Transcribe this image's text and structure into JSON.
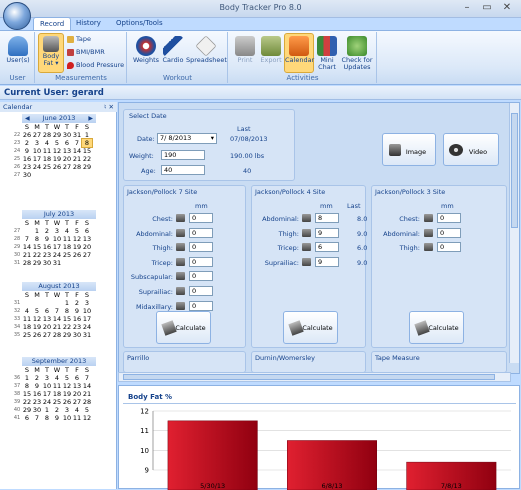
{
  "app": {
    "title": "Body Tracker Pro 8.0",
    "window_controls": [
      "–",
      "▭",
      "✕"
    ]
  },
  "tabs": [
    "Record",
    "History",
    "Options/Tools"
  ],
  "ribbon": {
    "user": {
      "button": "User(s)",
      "group": "User"
    },
    "measurements": {
      "body_fat_line1": "Body",
      "body_fat_line2": "Fat",
      "tape": "Tape",
      "bmi": "BMI/BMR",
      "blood_pressure": "Blood Pressure",
      "group": "Measurements"
    },
    "workout": {
      "weights": "Weights",
      "cardio": "Cardio",
      "spreadsheet": "Spreadsheet",
      "group": "Workout"
    },
    "activities": {
      "print": "Print",
      "export": "Export",
      "calendar": "Calendar",
      "mini_line1": "Mini",
      "mini_line2": "Chart",
      "check_line1": "Check for",
      "check_line2": "Updates",
      "group": "Activities"
    }
  },
  "user_bar": "Current User: gerard",
  "calendar": {
    "title": "Calendar",
    "pin": "♮ ✕",
    "months": [
      {
        "name": "June 2013",
        "weeks": [
          {
            "wk": "22",
            "days": [
              "26",
              "27",
              "28",
              "29",
              "30",
              "31",
              "1"
            ]
          },
          {
            "wk": "23",
            "days": [
              "2",
              "3",
              "4",
              "5",
              "6",
              "7",
              "8"
            ]
          },
          {
            "wk": "24",
            "days": [
              "9",
              "10",
              "11",
              "12",
              "13",
              "14",
              "15"
            ]
          },
          {
            "wk": "25",
            "days": [
              "16",
              "17",
              "18",
              "19",
              "20",
              "21",
              "22"
            ]
          },
          {
            "wk": "26",
            "days": [
              "23",
              "24",
              "25",
              "26",
              "27",
              "28",
              "29"
            ]
          },
          {
            "wk": "27",
            "days": [
              "30",
              "",
              "",
              "",
              "",
              "",
              ""
            ]
          }
        ]
      },
      {
        "name": "July 2013",
        "weeks": [
          {
            "wk": "27",
            "days": [
              "",
              "1",
              "2",
              "3",
              "4",
              "5",
              "6"
            ]
          },
          {
            "wk": "28",
            "days": [
              "7",
              "8",
              "9",
              "10",
              "11",
              "12",
              "13"
            ]
          },
          {
            "wk": "29",
            "days": [
              "14",
              "15",
              "16",
              "17",
              "18",
              "19",
              "20"
            ]
          },
          {
            "wk": "30",
            "days": [
              "21",
              "22",
              "23",
              "24",
              "25",
              "26",
              "27"
            ]
          },
          {
            "wk": "31",
            "days": [
              "28",
              "29",
              "30",
              "31",
              "",
              "",
              ""
            ]
          }
        ]
      },
      {
        "name": "August 2013",
        "weeks": [
          {
            "wk": "31",
            "days": [
              "",
              "",
              "",
              "",
              "1",
              "2",
              "3"
            ]
          },
          {
            "wk": "32",
            "days": [
              "4",
              "5",
              "6",
              "7",
              "8",
              "9",
              "10"
            ]
          },
          {
            "wk": "33",
            "days": [
              "11",
              "12",
              "13",
              "14",
              "15",
              "16",
              "17"
            ]
          },
          {
            "wk": "34",
            "days": [
              "18",
              "19",
              "20",
              "21",
              "22",
              "23",
              "24"
            ]
          },
          {
            "wk": "35",
            "days": [
              "25",
              "26",
              "27",
              "28",
              "29",
              "30",
              "31"
            ]
          }
        ]
      },
      {
        "name": "September 2013",
        "weeks": [
          {
            "wk": "36",
            "days": [
              "1",
              "2",
              "3",
              "4",
              "5",
              "6",
              "7"
            ]
          },
          {
            "wk": "37",
            "days": [
              "8",
              "9",
              "10",
              "11",
              "12",
              "13",
              "14"
            ]
          },
          {
            "wk": "38",
            "days": [
              "15",
              "16",
              "17",
              "18",
              "19",
              "20",
              "21"
            ]
          },
          {
            "wk": "39",
            "days": [
              "22",
              "23",
              "24",
              "25",
              "26",
              "27",
              "28"
            ]
          },
          {
            "wk": "40",
            "days": [
              "29",
              "30",
              "1",
              "2",
              "3",
              "4",
              "5"
            ]
          },
          {
            "wk": "41",
            "days": [
              "6",
              "7",
              "8",
              "9",
              "10",
              "11",
              "12"
            ]
          }
        ]
      }
    ],
    "dow": [
      "S",
      "M",
      "T",
      "W",
      "T",
      "F",
      "S"
    ]
  },
  "select_date": {
    "legend": "Select Date",
    "date_label": "Date:",
    "date_value": "7/ 8/2013",
    "last_label": "Last",
    "last_date": "07/08/2013",
    "weight_label": "Weight:",
    "weight_value": "190",
    "last_weight": "190.00 lbs",
    "age_label": "Age:",
    "age_value": "40",
    "last_age": "40"
  },
  "media": {
    "image": "Image",
    "video": "Video"
  },
  "jp7": {
    "legend": "Jackson/Pollock 7 Site",
    "unit": "mm",
    "rows": [
      {
        "label": "Chest:",
        "value": "0"
      },
      {
        "label": "Abdominal:",
        "value": "0"
      },
      {
        "label": "Thigh:",
        "value": "0"
      },
      {
        "label": "Tricep:",
        "value": "0"
      },
      {
        "label": "Subscapular:",
        "value": "0"
      },
      {
        "label": "Suprailiac:",
        "value": "0"
      },
      {
        "label": "Midaxillary:",
        "value": "0"
      }
    ],
    "calc": "Calculate"
  },
  "jp4": {
    "legend": "Jackson/Pollock 4 Site",
    "unit": "mm",
    "last": "Last",
    "rows": [
      {
        "label": "Abdominal:",
        "value": "8",
        "last": "8.0"
      },
      {
        "label": "Thigh:",
        "value": "9",
        "last": "9.0"
      },
      {
        "label": "Tricep:",
        "value": "6",
        "last": "6.0"
      },
      {
        "label": "Suprailiac:",
        "value": "9",
        "last": "9.0"
      }
    ],
    "calc": "Calculate"
  },
  "jp3": {
    "legend": "Jackson/Pollock 3 Site",
    "unit": "mm",
    "rows": [
      {
        "label": "Chest:",
        "value": "0"
      },
      {
        "label": "Abdominal:",
        "value": "0"
      },
      {
        "label": "Thigh:",
        "value": "0"
      }
    ],
    "calc": "Calculate"
  },
  "more_methods": [
    "Parrillo",
    "Durnin/Womersley",
    "Tape Measure"
  ],
  "chart_data": {
    "type": "bar",
    "title": "Body Fat %",
    "categories": [
      "5/30/13",
      "6/8/13",
      "7/8/13"
    ],
    "values": [
      11.5,
      10.5,
      9.4
    ],
    "y_ticks": [
      "12",
      "11",
      "10",
      "9"
    ],
    "ylim": [
      9,
      12
    ],
    "bar_color": "#c00010"
  }
}
